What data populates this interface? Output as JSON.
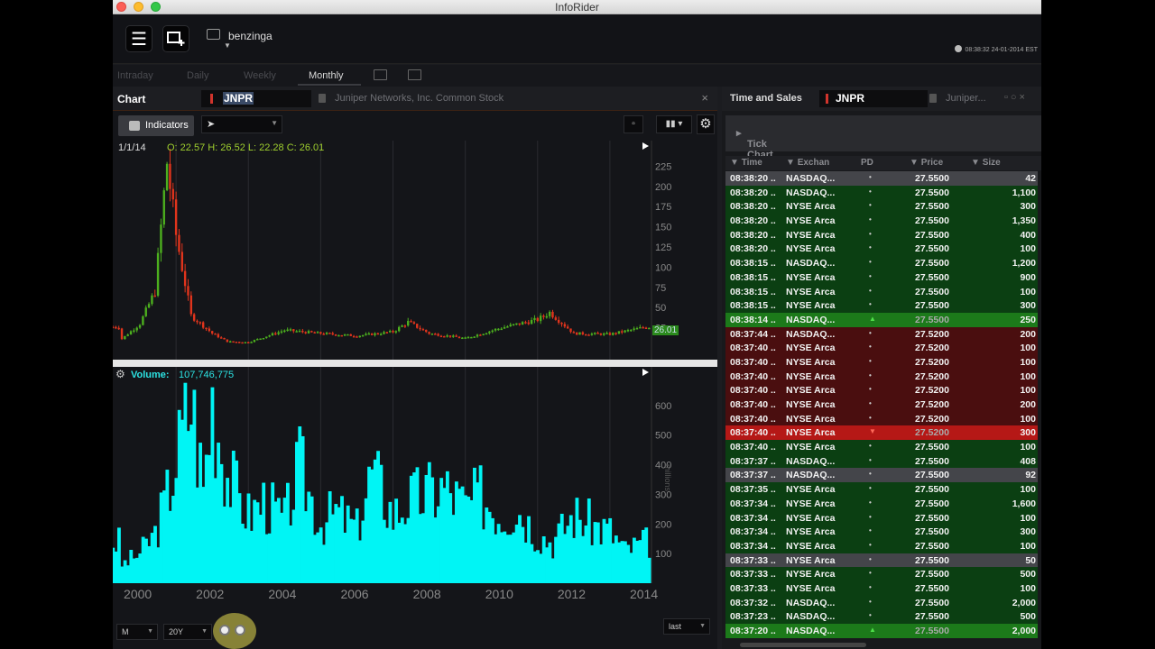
{
  "window": {
    "title": "InfoRider"
  },
  "toolbar": {
    "provider": "benzinga",
    "clock": "08:38:32 24-01-2014 EST"
  },
  "periods": [
    "Intraday",
    "Daily",
    "Weekly",
    "Monthly"
  ],
  "active_period": "Monthly",
  "chart_panel": {
    "title": "Chart",
    "symbol": "JNPR",
    "description": "Juniper Networks, Inc. Common Stock",
    "indicators_label": "Indicators",
    "ohlc_date": "1/1/14",
    "ohlc": "O: 22.57 H: 26.52 L: 22.28 C: 26.01",
    "last_price": "26.01",
    "volume_label": "Volume:",
    "volume_value": "107,746,775",
    "volume_unit": "millions",
    "interval_select": "M",
    "range_select": "20Y",
    "price_type_select": "last"
  },
  "chart_data": [
    {
      "type": "candlestick",
      "title": "",
      "x_ticks": [
        "2000",
        "2002",
        "2004",
        "2006",
        "2008",
        "2010",
        "2012",
        "2014"
      ],
      "yticks": [
        25,
        50,
        75,
        100,
        125,
        150,
        175,
        200,
        225
      ],
      "ylim": [
        0,
        240
      ],
      "grid": true,
      "x": [
        "1999-06",
        "2000-01",
        "2000-06",
        "2000-10",
        "2001-01",
        "2001-06",
        "2002-01",
        "2002-06",
        "2003-01",
        "2004-01",
        "2005-01",
        "2006-01",
        "2007-01",
        "2007-06",
        "2008-01",
        "2009-01",
        "2010-01",
        "2011-01",
        "2011-05",
        "2012-01",
        "2013-01",
        "2014-01"
      ],
      "close": [
        8,
        30,
        70,
        230,
        140,
        40,
        18,
        8,
        7,
        22,
        18,
        15,
        20,
        32,
        18,
        12,
        25,
        35,
        44,
        18,
        17,
        26.01
      ]
    },
    {
      "type": "bar",
      "title": "",
      "ylabel": "millions",
      "yticks": [
        100,
        200,
        300,
        400,
        500,
        600
      ],
      "ylim": [
        0,
        700
      ],
      "grid": true,
      "x": [
        "1999-06",
        "2000-01",
        "2000-06",
        "2000-10",
        "2001-01",
        "2001-06",
        "2001-10",
        "2002-01",
        "2002-06",
        "2003-01",
        "2003-06",
        "2004-01",
        "2004-06",
        "2005-01",
        "2005-06",
        "2006-01",
        "2006-06",
        "2007-01",
        "2007-06",
        "2008-01",
        "2008-06",
        "2009-01",
        "2009-06",
        "2010-01",
        "2010-06",
        "2011-01",
        "2011-06",
        "2012-01",
        "2012-06",
        "2013-01",
        "2013-06",
        "2014-01"
      ],
      "values": [
        60,
        110,
        180,
        320,
        450,
        680,
        350,
        680,
        400,
        250,
        300,
        230,
        420,
        220,
        260,
        200,
        410,
        250,
        300,
        330,
        350,
        280,
        320,
        250,
        280,
        180,
        150,
        250,
        220,
        190,
        120,
        150
      ]
    }
  ],
  "time_sales": {
    "title": "Time and Sales",
    "symbol": "JNPR",
    "description": "Juniper...",
    "tick_chart_label": "Tick Chart",
    "columns": [
      "Time",
      "Exchan",
      "PD",
      "Price",
      "Size"
    ],
    "rows": [
      {
        "time": "08:38:20 ..",
        "ex": "NASDAQ...",
        "pd": "•",
        "price": "27.5500",
        "size": "42",
        "style": "gray"
      },
      {
        "time": "08:38:20 ..",
        "ex": "NASDAQ...",
        "pd": "•",
        "price": "27.5500",
        "size": "1,100",
        "style": "green"
      },
      {
        "time": "08:38:20 ..",
        "ex": "NYSE Arca",
        "pd": "•",
        "price": "27.5500",
        "size": "300",
        "style": "green"
      },
      {
        "time": "08:38:20 ..",
        "ex": "NYSE Arca",
        "pd": "•",
        "price": "27.5500",
        "size": "1,350",
        "style": "green"
      },
      {
        "time": "08:38:20 ..",
        "ex": "NYSE Arca",
        "pd": "•",
        "price": "27.5500",
        "size": "400",
        "style": "green"
      },
      {
        "time": "08:38:20 ..",
        "ex": "NYSE Arca",
        "pd": "•",
        "price": "27.5500",
        "size": "100",
        "style": "green"
      },
      {
        "time": "08:38:15 ..",
        "ex": "NASDAQ...",
        "pd": "•",
        "price": "27.5500",
        "size": "1,200",
        "style": "green"
      },
      {
        "time": "08:38:15 ..",
        "ex": "NYSE Arca",
        "pd": "•",
        "price": "27.5500",
        "size": "900",
        "style": "green"
      },
      {
        "time": "08:38:15 ..",
        "ex": "NYSE Arca",
        "pd": "•",
        "price": "27.5500",
        "size": "100",
        "style": "green"
      },
      {
        "time": "08:38:15 ..",
        "ex": "NYSE Arca",
        "pd": "•",
        "price": "27.5500",
        "size": "300",
        "style": "green"
      },
      {
        "time": "08:38:14 ..",
        "ex": "NASDAQ...",
        "pd": "▲",
        "price": "27.5500",
        "size": "250",
        "style": "hl-green"
      },
      {
        "time": "08:37:44 ..",
        "ex": "NASDAQ...",
        "pd": "•",
        "price": "27.5200",
        "size": "200",
        "style": "red"
      },
      {
        "time": "08:37:40 ..",
        "ex": "NYSE Arca",
        "pd": "•",
        "price": "27.5200",
        "size": "100",
        "style": "red"
      },
      {
        "time": "08:37:40 ..",
        "ex": "NYSE Arca",
        "pd": "•",
        "price": "27.5200",
        "size": "100",
        "style": "red"
      },
      {
        "time": "08:37:40 ..",
        "ex": "NYSE Arca",
        "pd": "•",
        "price": "27.5200",
        "size": "100",
        "style": "red"
      },
      {
        "time": "08:37:40 ..",
        "ex": "NYSE Arca",
        "pd": "•",
        "price": "27.5200",
        "size": "100",
        "style": "red"
      },
      {
        "time": "08:37:40 ..",
        "ex": "NYSE Arca",
        "pd": "•",
        "price": "27.5200",
        "size": "200",
        "style": "red"
      },
      {
        "time": "08:37:40 ..",
        "ex": "NYSE Arca",
        "pd": "•",
        "price": "27.5200",
        "size": "100",
        "style": "red"
      },
      {
        "time": "08:37:40 ..",
        "ex": "NYSE Arca",
        "pd": "▼",
        "price": "27.5200",
        "size": "300",
        "style": "hl-red"
      },
      {
        "time": "08:37:40 ..",
        "ex": "NYSE Arca",
        "pd": "•",
        "price": "27.5500",
        "size": "100",
        "style": "green"
      },
      {
        "time": "08:37:37 ..",
        "ex": "NASDAQ...",
        "pd": "•",
        "price": "27.5500",
        "size": "408",
        "style": "green"
      },
      {
        "time": "08:37:37 ..",
        "ex": "NASDAQ...",
        "pd": "•",
        "price": "27.5500",
        "size": "92",
        "style": "gray"
      },
      {
        "time": "08:37:35 ..",
        "ex": "NYSE Arca",
        "pd": "•",
        "price": "27.5500",
        "size": "100",
        "style": "green"
      },
      {
        "time": "08:37:34 ..",
        "ex": "NYSE Arca",
        "pd": "•",
        "price": "27.5500",
        "size": "1,600",
        "style": "green"
      },
      {
        "time": "08:37:34 ..",
        "ex": "NYSE Arca",
        "pd": "•",
        "price": "27.5500",
        "size": "100",
        "style": "green"
      },
      {
        "time": "08:37:34 ..",
        "ex": "NYSE Arca",
        "pd": "•",
        "price": "27.5500",
        "size": "300",
        "style": "green"
      },
      {
        "time": "08:37:34 ..",
        "ex": "NYSE Arca",
        "pd": "•",
        "price": "27.5500",
        "size": "100",
        "style": "green"
      },
      {
        "time": "08:37:33 ..",
        "ex": "NYSE Arca",
        "pd": "•",
        "price": "27.5500",
        "size": "50",
        "style": "gray"
      },
      {
        "time": "08:37:33 ..",
        "ex": "NYSE Arca",
        "pd": "•",
        "price": "27.5500",
        "size": "500",
        "style": "green"
      },
      {
        "time": "08:37:33 ..",
        "ex": "NYSE Arca",
        "pd": "•",
        "price": "27.5500",
        "size": "100",
        "style": "green"
      },
      {
        "time": "08:37:32 ..",
        "ex": "NASDAQ...",
        "pd": "•",
        "price": "27.5500",
        "size": "2,000",
        "style": "green"
      },
      {
        "time": "08:37:23 ..",
        "ex": "NASDAQ...",
        "pd": "•",
        "price": "27.5500",
        "size": "500",
        "style": "green"
      },
      {
        "time": "08:37:20 ..",
        "ex": "NASDAQ...",
        "pd": "▲",
        "price": "27.5500",
        "size": "2,000",
        "style": "hl-green"
      }
    ]
  },
  "colors": {
    "candle_up": "#4caf1e",
    "candle_down": "#e0341c",
    "volume": "#00f5f5",
    "trade_up_bg": "#0b3f12",
    "trade_down_bg": "#4a0e0f"
  }
}
